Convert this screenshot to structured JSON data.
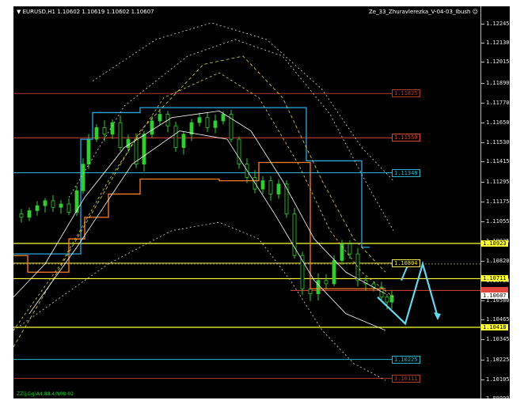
{
  "window": {
    "symbol_line": "EURUSD,H1  1.10602 1.10619 1.10602 1.10607",
    "indicator_name": "Ze_33_Zhuravlerezka_V-04-03_Ibush",
    "footer": "ZZ(j,Gg)A4,88,4/N08-02"
  },
  "price_axis": {
    "ticks": [
      "1.12245",
      "1.12130",
      "1.12015",
      "1.11890",
      "1.11770",
      "1.11650",
      "1.11530",
      "1.11415",
      "1.11295",
      "1.11175",
      "1.11055",
      "1.10935",
      "1.10820",
      "1.10700",
      "1.10580",
      "1.10465",
      "1.10345",
      "1.10225",
      "1.10105",
      "1.09990"
    ],
    "current_price": "1.10607",
    "axis_labels": [
      "1.10923",
      "1.10711",
      "1.10418"
    ],
    "min": 1.0999,
    "max": 1.12245
  },
  "levels": [
    {
      "label": "1.11825",
      "price": 1.11825,
      "color": "#b03a2e"
    },
    {
      "label": "1.11559",
      "price": 1.11559,
      "color": "#e0443a"
    },
    {
      "label": "1.11348",
      "price": 1.11348,
      "color": "#27b6c4"
    },
    {
      "label": "1.10804",
      "price": 1.10804,
      "color": "#f0e84a"
    },
    {
      "label": "1.10225",
      "price": 1.10225,
      "color": "#27b6c4"
    },
    {
      "label": "1.10111",
      "price": 1.10111,
      "color": "#b03a2e"
    }
  ],
  "colors": {
    "background": "#000000",
    "bull_candle": "#33cc33",
    "orange_channel": "#ff7f27",
    "blue_channel": "#29a9e0",
    "yellow_line": "#ffff33",
    "red_line": "#e0443a",
    "forecast_arrow": "#66d9ef"
  }
}
